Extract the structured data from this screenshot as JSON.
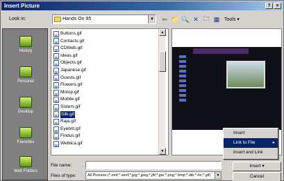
{
  "window": {
    "title": "Insert Picture",
    "controls": [
      "?",
      "×"
    ]
  },
  "toolbar": {
    "look_in_label": "Look in:",
    "look_in_value": "Hands On 95",
    "icons": [
      "back-icon",
      "up-folder-icon",
      "search-web-icon",
      "delete-icon",
      "new-folder-icon",
      "views-icon"
    ],
    "tools_label": "Tools ▾"
  },
  "places": [
    {
      "label": "History"
    },
    {
      "label": "Personal"
    },
    {
      "label": "Desktop"
    },
    {
      "label": "Favorites"
    },
    {
      "label": "Web Folders"
    }
  ],
  "files": [
    {
      "name": "Buttons.gif"
    },
    {
      "name": "Contacts.gif"
    },
    {
      "name": "CDWeb.gif"
    },
    {
      "name": "Ideas.gif"
    },
    {
      "name": "Objects.gif"
    },
    {
      "name": "Japanese.gif"
    },
    {
      "name": "Guests.gif"
    },
    {
      "name": "Flowers.gif"
    },
    {
      "name": "Motop.gif"
    },
    {
      "name": "Mobile.gif"
    },
    {
      "name": "Sisters.gif"
    },
    {
      "name": "Silk.gif",
      "selected": true
    },
    {
      "name": "Raja.gif"
    },
    {
      "name": "Eyebrit.gif"
    },
    {
      "name": "Findus.gif"
    },
    {
      "name": "Weblica.gif"
    }
  ],
  "context_menu": {
    "items": [
      {
        "label": "Insert",
        "highlighted": false
      },
      {
        "label": "Link to File",
        "highlighted": true,
        "submenu": true
      },
      {
        "label": "Insert and Link",
        "highlighted": false
      }
    ]
  },
  "footer": {
    "file_name_label": "File name:",
    "file_name_value": "",
    "file_type_label": "Files of type:",
    "file_type_value": "All Pictures (*.emf;*.wmf;*.jpg;*.jpeg;*.jfif;*.jpe;*.png;*.bmp;*.dib;*.rle;*.gif)",
    "insert_label": "Insert ▾",
    "cancel_label": "Cancel"
  },
  "colors": {
    "title_bar": "#0a246a",
    "selection": "#0a246a",
    "dialog_bg": "#d6d3ce",
    "places_bg": "#808080"
  }
}
